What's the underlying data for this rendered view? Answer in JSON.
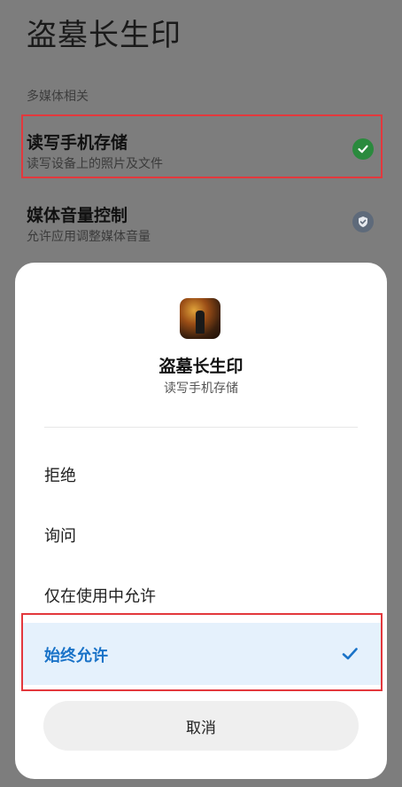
{
  "page": {
    "title": "盗墓长生印",
    "section_header": "多媒体相关"
  },
  "permissions": [
    {
      "title": "读写手机存储",
      "subtitle": "读写设备上的照片及文件",
      "status_icon": "check-circle-icon",
      "status_color": "#2a8a3d"
    },
    {
      "title": "媒体音量控制",
      "subtitle": "允许应用调整媒体音量",
      "status_icon": "shield-check-icon",
      "status_color": "#5e6a7a"
    }
  ],
  "dialog": {
    "app_icon": "game-app-icon",
    "app_name": "盗墓长生印",
    "permission_name": "读写手机存储",
    "options": [
      "拒绝",
      "询问",
      "仅在使用中允许",
      "始终允许"
    ],
    "selected_option": "始终允许",
    "cancel_label": "取消",
    "accent_color": "#1a73c8",
    "highlight_color": "#e3383d"
  }
}
